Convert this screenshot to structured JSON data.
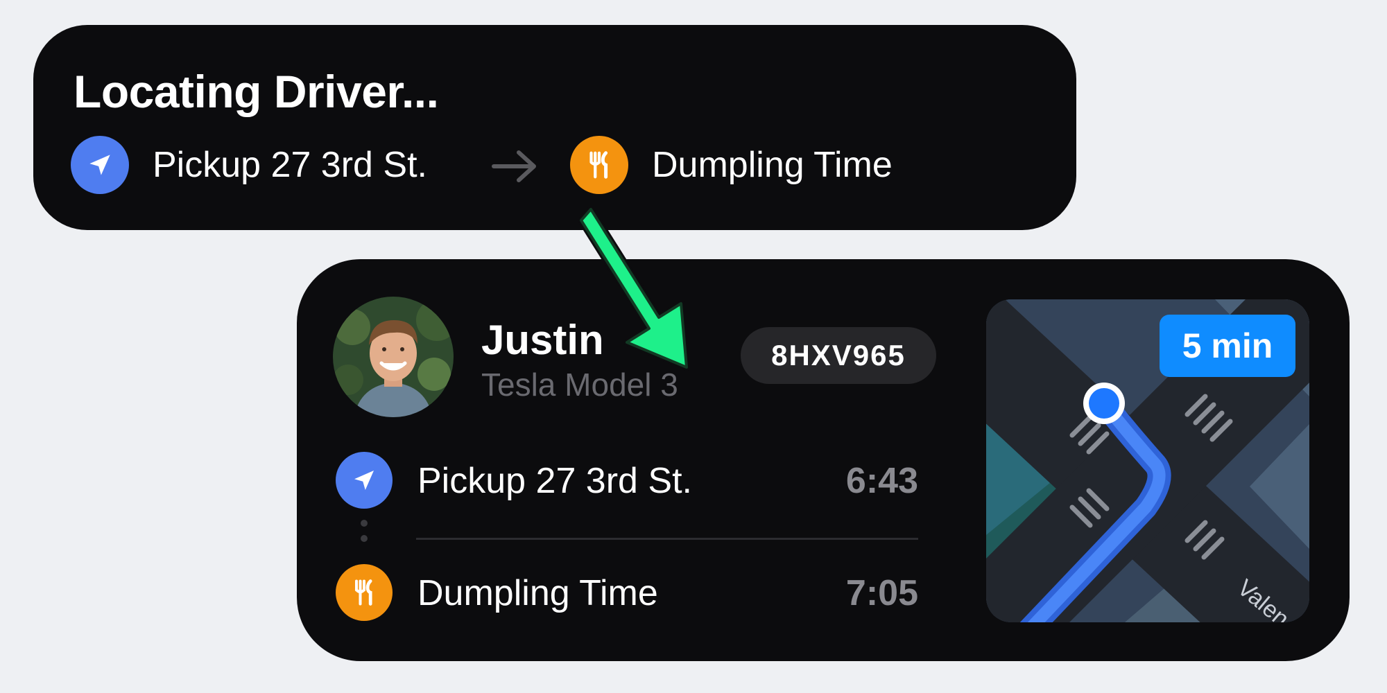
{
  "compact": {
    "title": "Locating Driver...",
    "pickup_label": "Pickup 27 3rd St.",
    "destination_label": "Dumpling Time"
  },
  "expanded": {
    "driver_name": "Justin",
    "vehicle": "Tesla Model 3",
    "plate": "8HXV965",
    "stops": [
      {
        "label": "Pickup 27 3rd St.",
        "time": "6:43",
        "icon": "navigation-arrow-icon"
      },
      {
        "label": "Dumpling Time",
        "time": "7:05",
        "icon": "fork-knife-icon"
      }
    ],
    "map": {
      "eta": "5 min",
      "street_label": "Valen"
    }
  },
  "colors": {
    "panel": "#0c0c0e",
    "pickup_icon": "#4f7df0",
    "destination_icon": "#f4930f",
    "eta_badge": "#0f8cff",
    "route": "#3a7cf5",
    "annotation_arrow": "#1ef08a"
  }
}
